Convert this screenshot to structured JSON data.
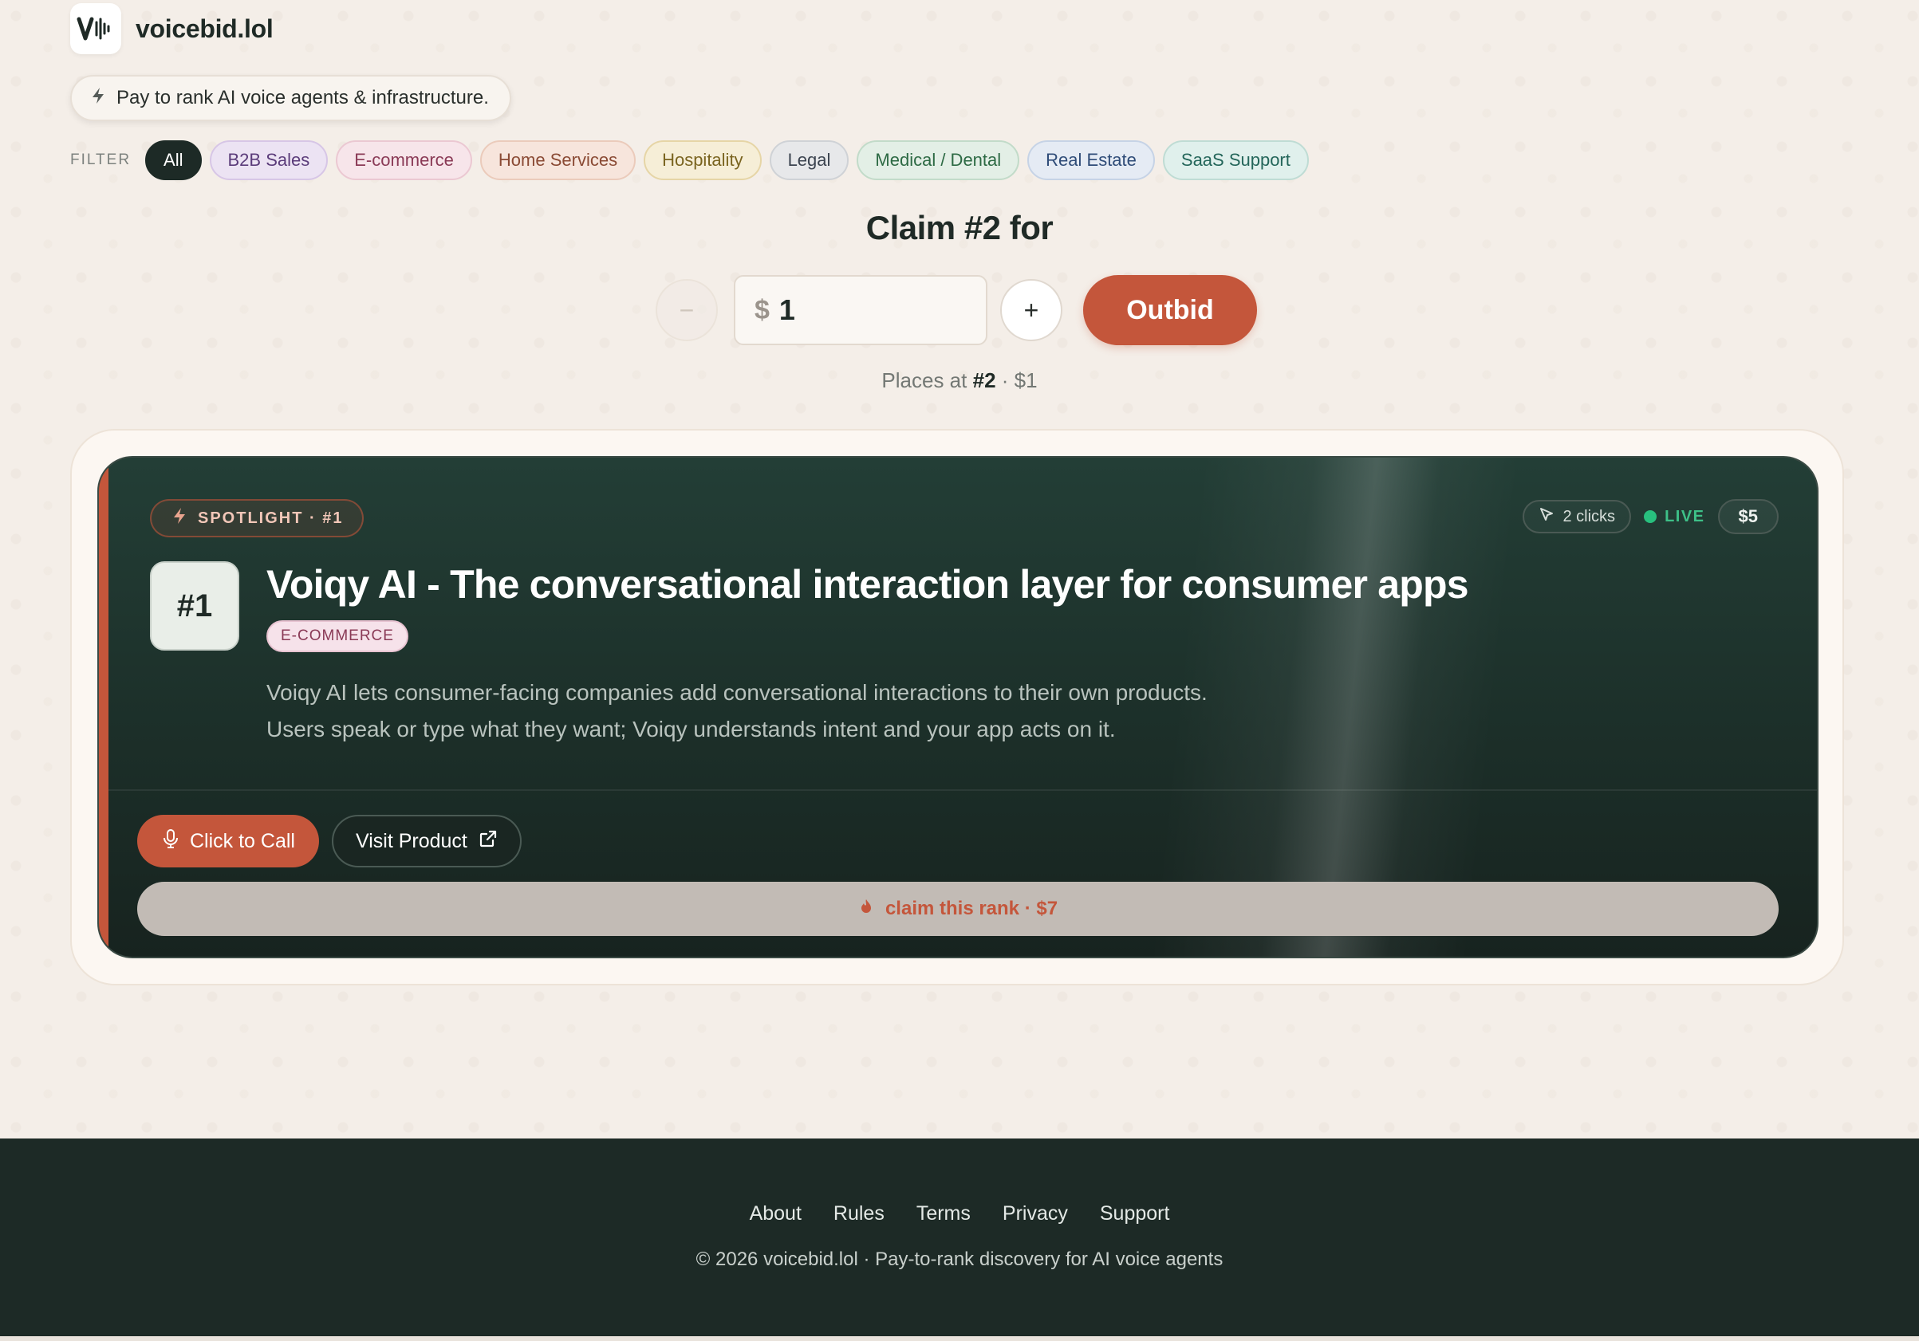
{
  "brand": {
    "name": "voicebid.lol"
  },
  "tagline": "Pay to rank AI voice agents & infrastructure.",
  "filters": {
    "label": "FILTER",
    "items": [
      {
        "label": "All",
        "active": true,
        "bg": "#1d2a26",
        "border": "#1d2a26",
        "color": "#ffffff"
      },
      {
        "label": "B2B Sales",
        "bg": "#ece3f3",
        "border": "#d7c6e6",
        "color": "#5b3c7a"
      },
      {
        "label": "E-commerce",
        "bg": "#f7e5ea",
        "border": "#ebc8d2",
        "color": "#8a3a56"
      },
      {
        "label": "Home Services",
        "bg": "#f7e5dc",
        "border": "#ebcbbb",
        "color": "#8a4a34"
      },
      {
        "label": "Hospitality",
        "bg": "#f6eed7",
        "border": "#e6d5a6",
        "color": "#7a6420"
      },
      {
        "label": "Legal",
        "bg": "#e7e8ea",
        "border": "#cfd2d6",
        "color": "#3c4450"
      },
      {
        "label": "Medical / Dental",
        "bg": "#e3efe6",
        "border": "#c2dbc9",
        "color": "#2d6a44"
      },
      {
        "label": "Real Estate",
        "bg": "#e5ebf4",
        "border": "#c6d3e6",
        "color": "#2f4c78"
      },
      {
        "label": "SaaS Support",
        "bg": "#e0f0ec",
        "border": "#bfdcd4",
        "color": "#24665a"
      }
    ]
  },
  "bid": {
    "title": "Claim #2 for",
    "currency": "$",
    "amount": "1",
    "minus": "−",
    "plus": "+",
    "button": "Outbid",
    "places_prefix": "Places at",
    "places_rank": "#2",
    "places_suffix": "· $1"
  },
  "spotlight": {
    "badge": "SPOTLIGHT · #1",
    "clicks": "2 clicks",
    "live": "LIVE",
    "price": "$5",
    "rank": "#1",
    "title": "Voiqy AI - The conversational interaction layer for consumer apps",
    "category": "E-COMMERCE",
    "description_lines": [
      "Voiqy AI lets consumer-facing companies add conversational interactions to their own products.",
      "Users speak or type what they want; Voiqy understands intent and your app acts on it."
    ],
    "call_button": "Click to Call",
    "visit_button": "Visit Product",
    "claim_text": "claim this rank · $7"
  },
  "footer": {
    "links": [
      "About",
      "Rules",
      "Terms",
      "Privacy",
      "Support"
    ],
    "copyright": "© 2026 voicebid.lol · Pay-to-rank discovery for AI voice agents"
  },
  "colors": {
    "accent": "#c4563b",
    "dark": "#1d2a26",
    "live": "#28c07e"
  },
  "icons": [
    "voicebid-logo-icon",
    "bolt-icon",
    "cursor-icon",
    "microphone-icon",
    "external-link-icon",
    "fire-icon"
  ]
}
